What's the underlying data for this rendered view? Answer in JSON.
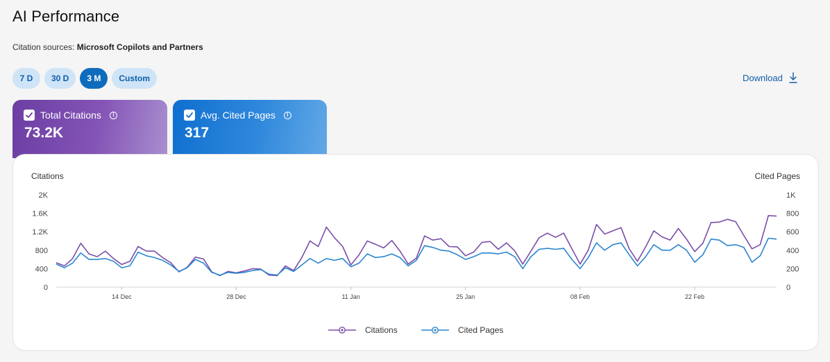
{
  "page": {
    "title": "AI Performance",
    "sources_label": "Citation sources:",
    "sources_value": "Microsoft Copilots and Partners"
  },
  "ranges": [
    {
      "label": "7 D",
      "active": false
    },
    {
      "label": "30 D",
      "active": false
    },
    {
      "label": "3 M",
      "active": true
    },
    {
      "label": "Custom",
      "active": false
    }
  ],
  "download": {
    "label": "Download",
    "icon": "download-icon"
  },
  "kpis": {
    "citations": {
      "label": "Total Citations",
      "value": "73.2K",
      "checked": true,
      "info_icon": "info-icon"
    },
    "pages": {
      "label": "Avg. Cited Pages",
      "value": "317",
      "checked": true,
      "info_icon": "info-icon"
    }
  },
  "colors": {
    "citations": "#7a4ea8",
    "cited_pages": "#2a86d1",
    "active_range": "#0f6cbd",
    "range_bg": "#cfe4f7"
  },
  "chart_data": {
    "type": "line",
    "left_axis_title": "Citations",
    "right_axis_title": "Cited Pages",
    "left_ticks": [
      "0",
      "400",
      "800",
      "1.2K",
      "1.6K",
      "2K"
    ],
    "left_range": [
      0,
      2000
    ],
    "right_ticks": [
      "0",
      "200",
      "400",
      "600",
      "800",
      "1K"
    ],
    "right_range": [
      0,
      1000
    ],
    "x_labels": [
      {
        "label": "14 Dec",
        "index": 8
      },
      {
        "label": "28 Dec",
        "index": 22
      },
      {
        "label": "11 Jan",
        "index": 36
      },
      {
        "label": "25 Jan",
        "index": 50
      },
      {
        "label": "08 Feb",
        "index": 64
      },
      {
        "label": "22 Feb",
        "index": 78
      }
    ],
    "series": [
      {
        "name": "Citations",
        "axis": "left",
        "values": [
          530,
          460,
          620,
          950,
          720,
          660,
          780,
          620,
          490,
          560,
          880,
          780,
          780,
          640,
          530,
          330,
          430,
          650,
          610,
          330,
          250,
          340,
          310,
          350,
          400,
          390,
          260,
          250,
          460,
          360,
          640,
          1000,
          880,
          1300,
          1070,
          880,
          480,
          700,
          1000,
          930,
          850,
          1010,
          780,
          500,
          630,
          1110,
          1020,
          1050,
          880,
          870,
          680,
          760,
          970,
          990,
          820,
          960,
          790,
          500,
          780,
          1070,
          1170,
          1080,
          1170,
          830,
          500,
          800,
          1360,
          1150,
          1220,
          1290,
          830,
          560,
          870,
          1220,
          1090,
          1020,
          1270,
          1040,
          770,
          950,
          1400,
          1410,
          1470,
          1420,
          1120,
          830,
          920,
          1550,
          1540
        ]
      },
      {
        "name": "Cited Pages",
        "axis": "right",
        "values": [
          250,
          210,
          260,
          370,
          300,
          300,
          310,
          280,
          210,
          230,
          380,
          340,
          320,
          290,
          240,
          170,
          210,
          300,
          260,
          160,
          130,
          160,
          150,
          160,
          180,
          190,
          140,
          130,
          210,
          170,
          240,
          310,
          260,
          310,
          290,
          310,
          220,
          260,
          360,
          320,
          330,
          360,
          320,
          230,
          290,
          450,
          430,
          400,
          390,
          350,
          300,
          330,
          370,
          370,
          360,
          380,
          330,
          200,
          330,
          410,
          420,
          410,
          420,
          300,
          200,
          320,
          480,
          400,
          460,
          480,
          350,
          230,
          330,
          460,
          400,
          400,
          460,
          400,
          270,
          350,
          520,
          510,
          450,
          460,
          430,
          270,
          340,
          530,
          520
        ]
      }
    ]
  }
}
